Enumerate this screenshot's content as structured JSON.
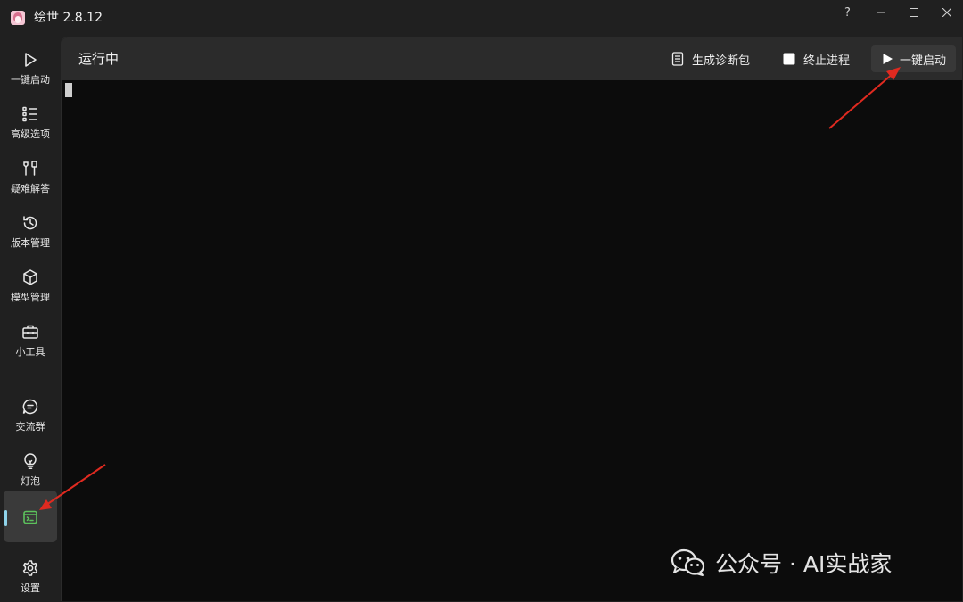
{
  "window": {
    "title": "绘世 2.8.12",
    "controls": {
      "help": "?",
      "minimize": "─",
      "maximize": "☐",
      "close": "✕"
    }
  },
  "sidebar": {
    "items": [
      {
        "label": "一键启动",
        "icon": "play-icon"
      },
      {
        "label": "高级选项",
        "icon": "list-icon"
      },
      {
        "label": "疑难解答",
        "icon": "tools-icon"
      },
      {
        "label": "版本管理",
        "icon": "history-icon"
      },
      {
        "label": "模型管理",
        "icon": "cube-icon"
      },
      {
        "label": "小工具",
        "icon": "toolbox-icon"
      },
      {
        "label": "交流群",
        "icon": "chat-icon"
      },
      {
        "label": "灯泡",
        "icon": "lightbulb-icon"
      },
      {
        "label": "",
        "icon": "terminal-icon",
        "active": true
      },
      {
        "label": "设置",
        "icon": "gear-icon"
      }
    ],
    "active_color": "#8fd3ea",
    "terminal_icon_color": "#5cc15c"
  },
  "main": {
    "title": "运行中",
    "actions": {
      "diagnostic": "生成诊断包",
      "stop": "终止进程",
      "launch": "一键启动"
    },
    "console_background": "#0c0c0c"
  },
  "annotation": {
    "arrow_color": "#e02a20"
  },
  "watermark": {
    "text": "公众号 · AI实战家"
  }
}
